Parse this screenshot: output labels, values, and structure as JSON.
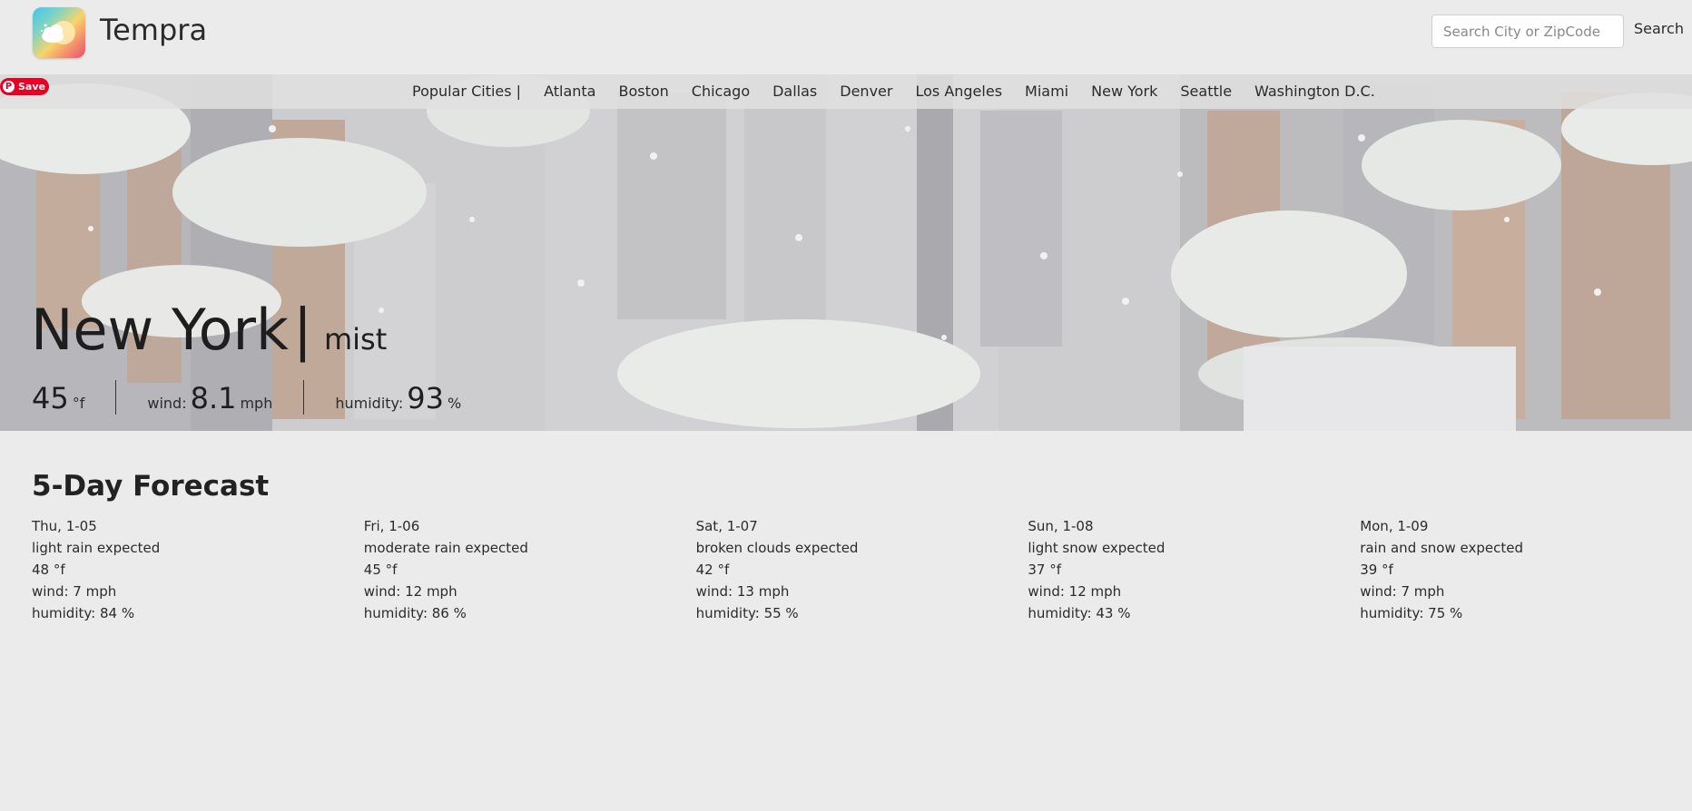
{
  "header": {
    "brand": "Tempra",
    "logo_icon": "sun-cloud-logo-icon",
    "search_placeholder": "Search City or ZipCode",
    "search_value": "",
    "search_label": "Search"
  },
  "nav": {
    "label": "Popular Cities |",
    "cities": [
      "Atlanta",
      "Boston",
      "Chicago",
      "Dallas",
      "Denver",
      "Los Angeles",
      "Miami",
      "New York",
      "Seattle",
      "Washington D.C."
    ]
  },
  "pinterest": {
    "label": "Save",
    "icon": "pinterest-icon",
    "color": "#e60023"
  },
  "current": {
    "city": "New York",
    "separator": "|",
    "condition": "mist",
    "temp": "45",
    "temp_unit": "°f",
    "wind_label": "wind:",
    "wind": "8.1",
    "wind_unit": "mph",
    "humidity_label": "humidity:",
    "humidity": "93",
    "humidity_unit": "%"
  },
  "forecast": {
    "title": "5-Day Forecast",
    "days": [
      {
        "date": "Thu, 1-05",
        "desc": "light rain expected",
        "temp": "48 °f",
        "wind": "wind: 7 mph",
        "humidity": "humidity: 84 %"
      },
      {
        "date": "Fri, 1-06",
        "desc": "moderate rain expected",
        "temp": "45 °f",
        "wind": "wind: 12 mph",
        "humidity": "humidity: 86 %"
      },
      {
        "date": "Sat, 1-07",
        "desc": "broken clouds expected",
        "temp": "42 °f",
        "wind": "wind: 13 mph",
        "humidity": "humidity: 55 %"
      },
      {
        "date": "Sun, 1-08",
        "desc": "light snow expected",
        "temp": "37 °f",
        "wind": "wind: 12 mph",
        "humidity": "humidity: 43 %"
      },
      {
        "date": "Mon, 1-09",
        "desc": "rain and snow expected",
        "temp": "39 °f",
        "wind": "wind: 7 mph",
        "humidity": "humidity: 75 %"
      }
    ]
  }
}
